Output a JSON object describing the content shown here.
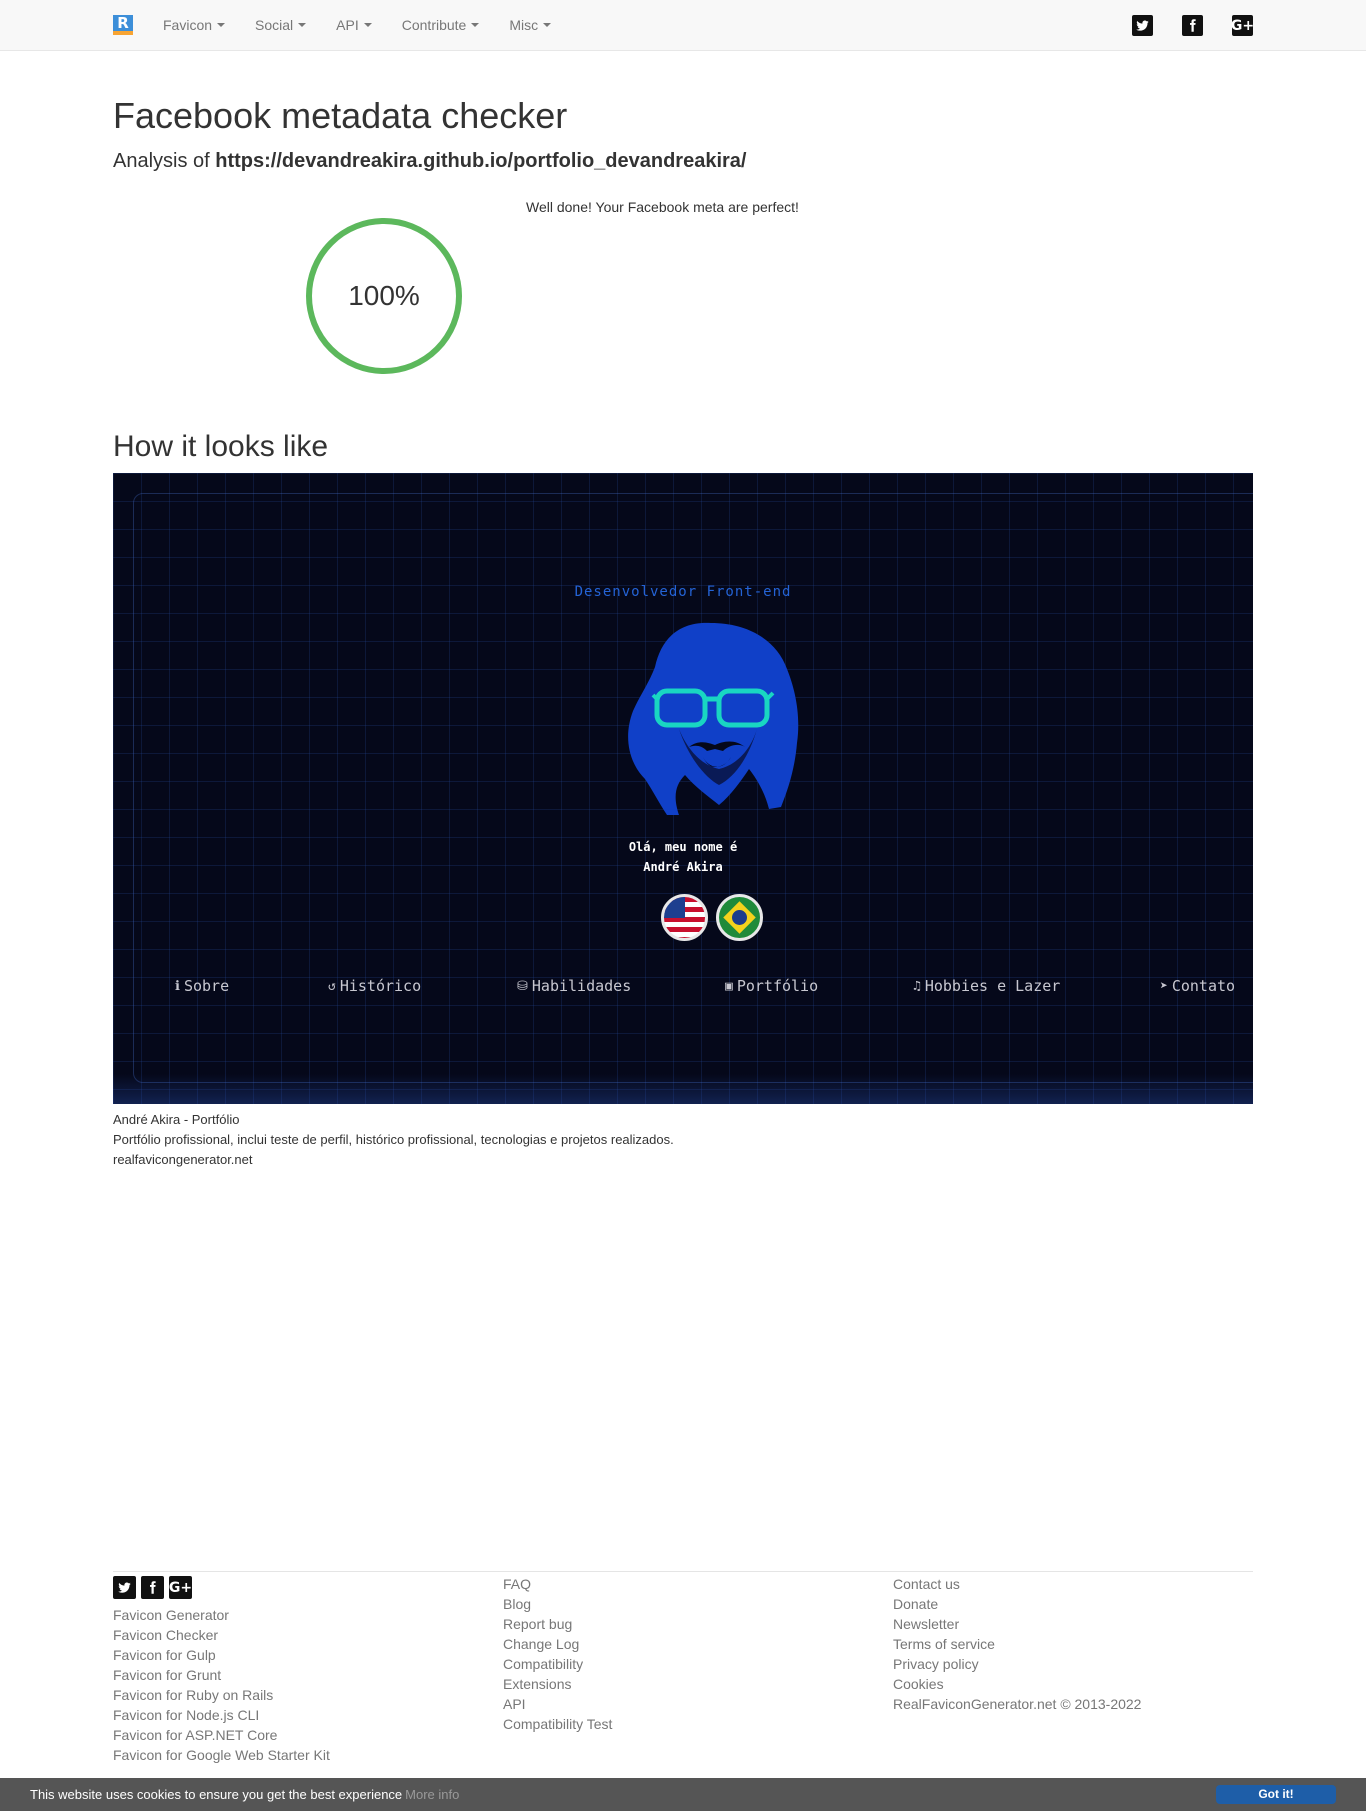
{
  "navbar": {
    "brand_letter": "R",
    "menus": [
      {
        "label": "Favicon"
      },
      {
        "label": "Social"
      },
      {
        "label": "API"
      },
      {
        "label": "Contribute"
      },
      {
        "label": "Misc"
      }
    ],
    "social": [
      {
        "icon": "twitter-icon"
      },
      {
        "icon": "facebook-icon"
      },
      {
        "icon": "google-plus-icon",
        "glyph": "G+"
      }
    ]
  },
  "main": {
    "title": "Facebook metadata checker",
    "analysis_prefix": "Analysis of ",
    "analysis_url": "https://devandreakira.github.io/portfolio_devandreakira/",
    "score_text": "100%",
    "score_value": 1.0,
    "score_color": "#5cb85c",
    "result_message": "Well done! Your Facebook meta are perfect!",
    "section_title": "How it looks like"
  },
  "preview": {
    "subtitle": "Desenvolvedor Front-end",
    "greeting_line1": "Olá, meu nome é",
    "greeting_line2": "André Akira",
    "flags": [
      "us-flag",
      "brazil-flag"
    ],
    "nav": [
      {
        "icon": "info-icon",
        "glyph": "ℹ",
        "label": "Sobre"
      },
      {
        "icon": "history-icon",
        "glyph": "↺",
        "label": "Histórico"
      },
      {
        "icon": "skills-icon",
        "glyph": "⛁",
        "label": "Habilidades"
      },
      {
        "icon": "portfolio-icon",
        "glyph": "▣",
        "label": "Portfólio"
      },
      {
        "icon": "music-icon",
        "glyph": "♫",
        "label": "Hobbies e Lazer"
      },
      {
        "icon": "send-icon",
        "glyph": "➤",
        "label": "Contato"
      }
    ],
    "accent_color": "#2463d6",
    "background_color": "#05081a"
  },
  "caption": {
    "title": "André Akira - Portfólio",
    "description": "Portfólio profissional, inclui teste de perfil, histórico profissional, tecnologias e projetos realizados.",
    "domain": "realfavicongenerator.net"
  },
  "footer": {
    "col1": [
      "Favicon Generator",
      "Favicon Checker",
      "Favicon for Gulp",
      "Favicon for Grunt",
      "Favicon for Ruby on Rails",
      "Favicon for Node.js CLI",
      "Favicon for ASP.NET Core",
      "Favicon for Google Web Starter Kit"
    ],
    "col2": [
      "FAQ",
      "Blog",
      "Report bug",
      "Change Log",
      "Compatibility",
      "Extensions",
      "API",
      "Compatibility Test"
    ],
    "col3": [
      "Contact us",
      "Donate",
      "Newsletter",
      "Terms of service",
      "Privacy policy",
      "Cookies"
    ],
    "copyright": "RealFaviconGenerator.net © 2013-2022"
  },
  "cookie": {
    "text": "This website uses cookies to ensure you get the best experience",
    "more": "More info",
    "button": "Got it!"
  }
}
